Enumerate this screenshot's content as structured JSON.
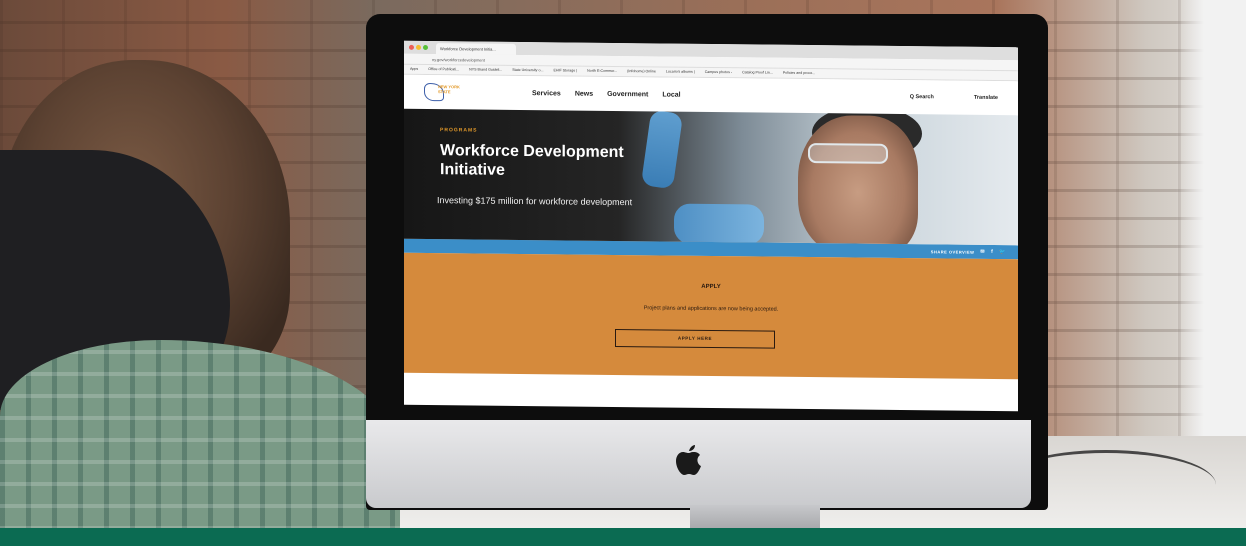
{
  "browser": {
    "tab_title": "Workforce Development Initia...",
    "url": "ny.gov/workforcedevelopment",
    "bookmarks": [
      "Apps",
      "Office of Publicati...",
      "NYS Brand Guideli...",
      "State University o...",
      "EHIF Storage |",
      "North E-Commer...",
      "(Infohome) Online",
      "Lucario's albums |",
      "Campus photos -",
      "Catalog Proof Lin...",
      "Policies and proce..."
    ]
  },
  "site": {
    "logo_text": "NEW YORK STATE",
    "nav": [
      "Services",
      "News",
      "Government",
      "Local"
    ],
    "search_label": "Q Search",
    "translate_label": "Translate"
  },
  "hero": {
    "eyebrow": "PROGRAMS",
    "title": "Workforce Development Initiative",
    "subtitle": "Investing $175 million for workforce development"
  },
  "share": {
    "label": "SHARE OVERVIEW",
    "icons": [
      "mail-icon",
      "facebook-icon",
      "twitter-icon"
    ]
  },
  "apply": {
    "title": "APPLY",
    "text": "Project plans and applications are now being accepted.",
    "button": "APPLY HERE"
  },
  "colors": {
    "accent_orange": "#d58a3c",
    "share_blue": "#3b8ec8",
    "bottom_band_green": "#0b6b52"
  }
}
